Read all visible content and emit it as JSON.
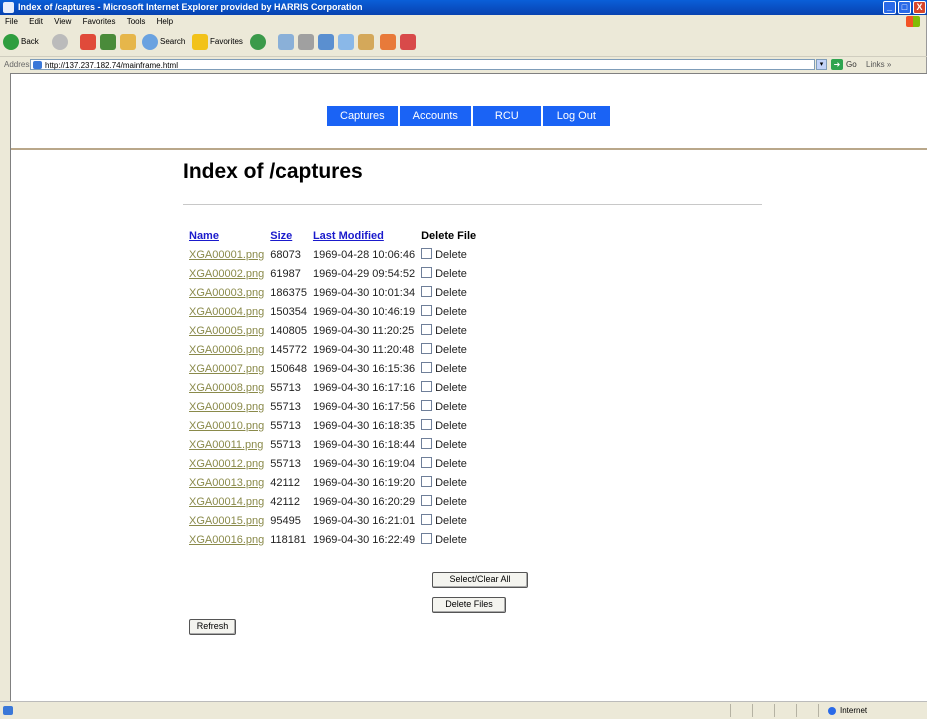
{
  "window": {
    "title": "Index of /captures - Microsoft Internet Explorer provided by HARRIS Corporation",
    "controls": [
      "_",
      "□",
      "X"
    ]
  },
  "menu": [
    "File",
    "Edit",
    "View",
    "Favorites",
    "Tools",
    "Help"
  ],
  "toolbar": {
    "back": "Back",
    "search": "Search",
    "favorites": "Favorites"
  },
  "address": {
    "label": "Address",
    "url": "http://137.237.182.74/mainframe.html",
    "go": "Go",
    "links": "Links"
  },
  "nav": [
    "Captures",
    "Accounts",
    "RCU",
    "Log Out"
  ],
  "page_title": "Index of /captures",
  "table": {
    "headers": {
      "name": "Name",
      "size": "Size",
      "modified": "Last Modified",
      "delete": "Delete File"
    },
    "delete_label": "Delete",
    "rows": [
      {
        "name": "XGA00001.png",
        "size": "68073",
        "modified": "1969-04-28 10:06:46"
      },
      {
        "name": "XGA00002.png",
        "size": "61987",
        "modified": "1969-04-29 09:54:52"
      },
      {
        "name": "XGA00003.png",
        "size": "186375",
        "modified": "1969-04-30 10:01:34"
      },
      {
        "name": "XGA00004.png",
        "size": "150354",
        "modified": "1969-04-30 10:46:19"
      },
      {
        "name": "XGA00005.png",
        "size": "140805",
        "modified": "1969-04-30 11:20:25"
      },
      {
        "name": "XGA00006.png",
        "size": "145772",
        "modified": "1969-04-30 11:20:48"
      },
      {
        "name": "XGA00007.png",
        "size": "150648",
        "modified": "1969-04-30 16:15:36"
      },
      {
        "name": "XGA00008.png",
        "size": "55713",
        "modified": "1969-04-30 16:17:16"
      },
      {
        "name": "XGA00009.png",
        "size": "55713",
        "modified": "1969-04-30 16:17:56"
      },
      {
        "name": "XGA00010.png",
        "size": "55713",
        "modified": "1969-04-30 16:18:35"
      },
      {
        "name": "XGA00011.png",
        "size": "55713",
        "modified": "1969-04-30 16:18:44"
      },
      {
        "name": "XGA00012.png",
        "size": "55713",
        "modified": "1969-04-30 16:19:04"
      },
      {
        "name": "XGA00013.png",
        "size": "42112",
        "modified": "1969-04-30 16:19:20"
      },
      {
        "name": "XGA00014.png",
        "size": "42112",
        "modified": "1969-04-30 16:20:29"
      },
      {
        "name": "XGA00015.png",
        "size": "95495",
        "modified": "1969-04-30 16:21:01"
      },
      {
        "name": "XGA00016.png",
        "size": "118181",
        "modified": "1969-04-30 16:22:49"
      }
    ]
  },
  "buttons": {
    "select_clear": "Select/Clear All",
    "delete_files": "Delete Files",
    "refresh": "Refresh"
  },
  "status": {
    "zone": "Internet"
  },
  "colors": {
    "nav_bg": "#1a63f5",
    "link": "#1a1acc",
    "file_link": "#8a8a4a"
  }
}
